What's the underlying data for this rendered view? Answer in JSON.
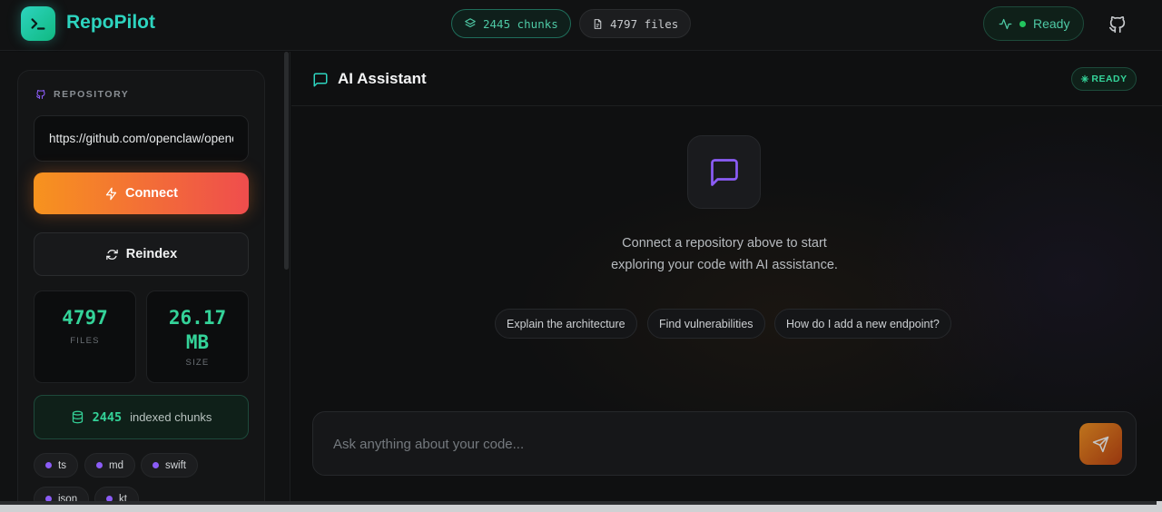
{
  "app": {
    "name": "RepoPilot",
    "colors": {
      "accent": "#2dd4bf",
      "success": "#34d399",
      "cta_start": "#f7931e",
      "cta_end": "#ef4d4d",
      "tag_dot": "#8b5cf6"
    }
  },
  "header": {
    "chunks_pill": "2445 chunks",
    "files_pill": "4797 files",
    "status": "Ready",
    "icons": {
      "logo": "terminal-icon",
      "chunks": "layers-icon",
      "files": "file-icon",
      "status": "activity-icon",
      "github": "github-icon"
    }
  },
  "sidebar": {
    "section_label": "REPOSITORY",
    "repo_url": "https://github.com/openclaw/openclaw",
    "connect_label": "Connect",
    "reindex_label": "Reindex",
    "stats": {
      "files_value": "4797",
      "files_label": "FILES",
      "size_value_line1": "26.17",
      "size_value_line2": "MB",
      "size_label": "SIZE"
    },
    "chunks": {
      "count": "2445",
      "label": "indexed chunks"
    },
    "tags": [
      "ts",
      "md",
      "swift",
      "json",
      "kt"
    ]
  },
  "assistant": {
    "title": "AI Assistant",
    "badge": "READY",
    "empty_line1": "Connect a repository above to start",
    "empty_line2": "exploring your code with AI assistance.",
    "suggestions": [
      "Explain the architecture",
      "Find vulnerabilities",
      "How do I add a new endpoint?"
    ],
    "input_placeholder": "Ask anything about your code..."
  }
}
